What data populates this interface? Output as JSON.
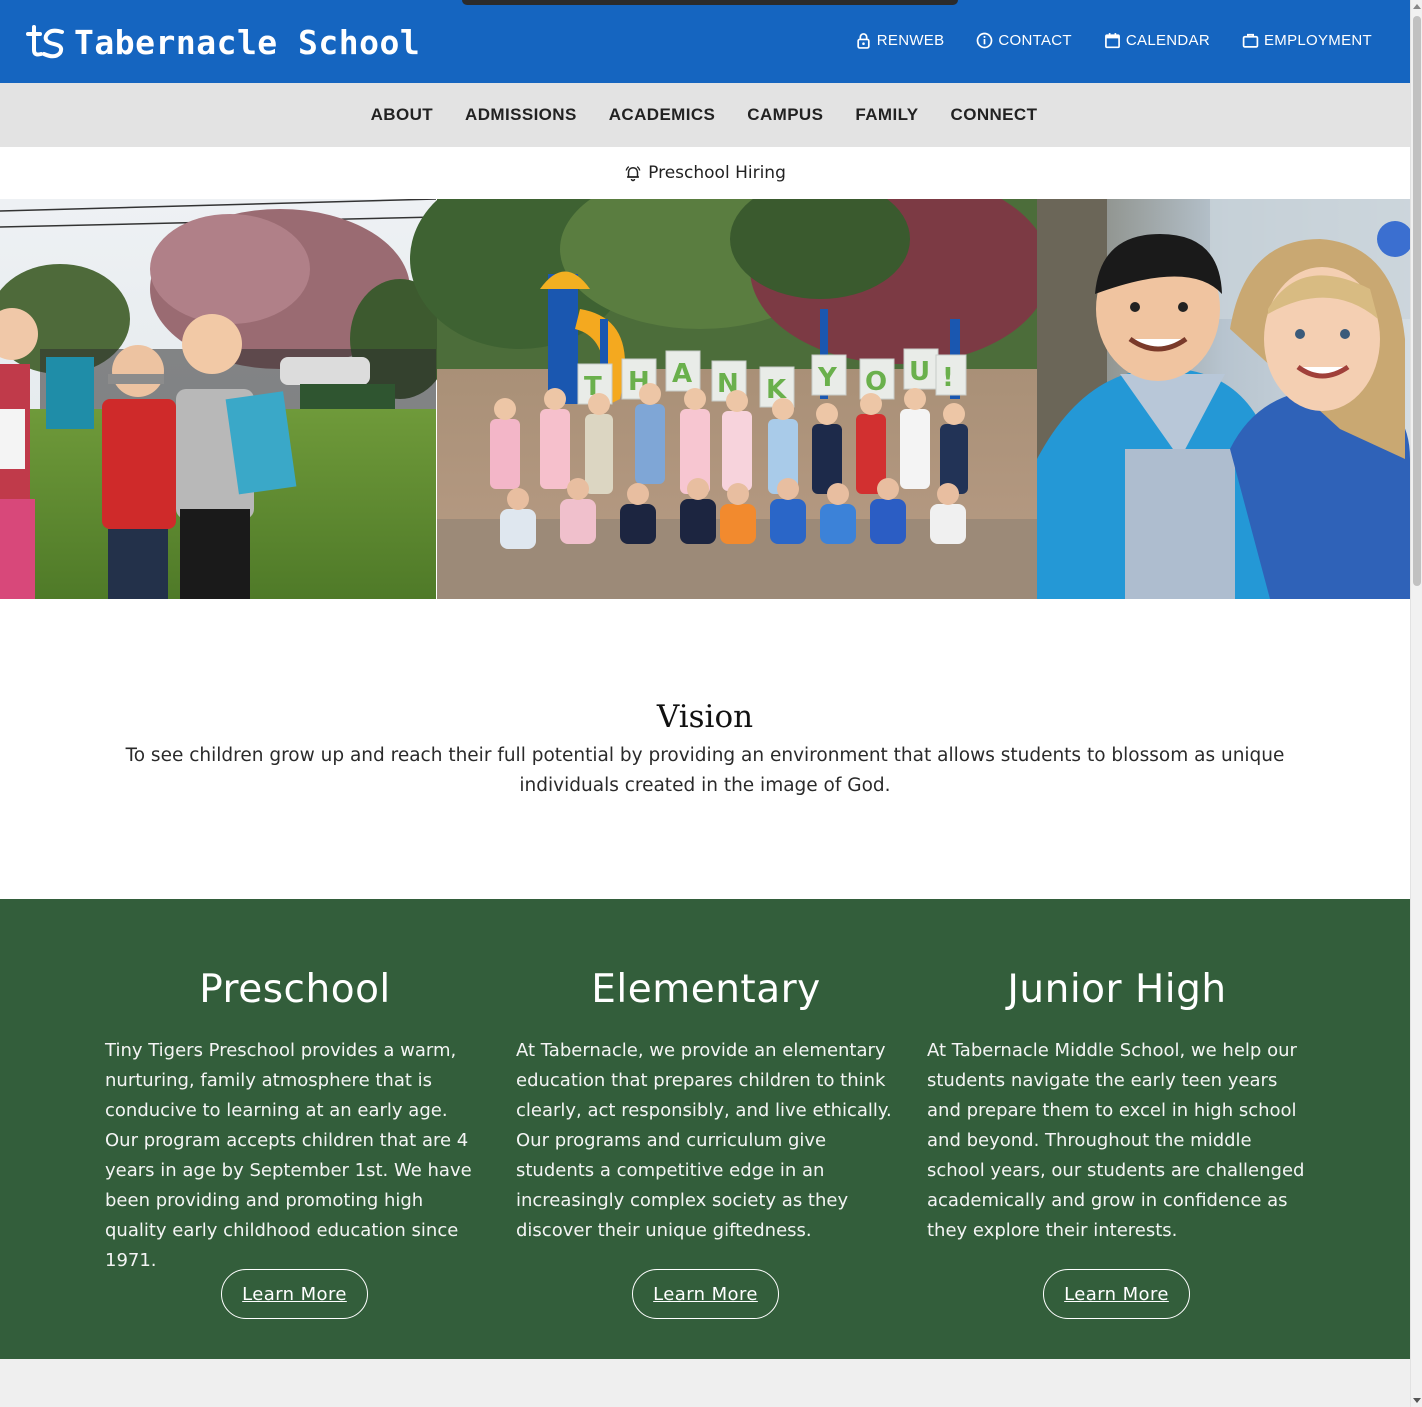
{
  "header": {
    "brand": "Tabernacle School",
    "utility_links": [
      {
        "label": "RENWEB",
        "icon": "lock-icon"
      },
      {
        "label": "CONTACT",
        "icon": "info-icon"
      },
      {
        "label": "CALENDAR",
        "icon": "calendar-icon"
      },
      {
        "label": "EMPLOYMENT",
        "icon": "briefcase-icon"
      }
    ],
    "colors": {
      "header_blue": "#1565c0",
      "nav_gray": "#e3e3e3"
    }
  },
  "main_nav": [
    {
      "label": "ABOUT"
    },
    {
      "label": "ADMISSIONS"
    },
    {
      "label": "ACADEMICS"
    },
    {
      "label": "CAMPUS"
    },
    {
      "label": "FAMILY"
    },
    {
      "label": "CONNECT"
    }
  ],
  "alert": {
    "icon": "bell-icon",
    "text": "Preschool Hiring"
  },
  "hero": {
    "slides": [
      {
        "name": "kids-with-books-photo"
      },
      {
        "name": "thank-you-playground-photo"
      },
      {
        "name": "smiling-students-photo"
      }
    ]
  },
  "vision": {
    "title": "Vision",
    "text": "To see children grow up and reach their full potential by providing an environment that allows students to blossom as unique individuals created in the image of God."
  },
  "programs": {
    "background": "#335e3b",
    "items": [
      {
        "title": "Preschool",
        "text": "Tiny Tigers  Preschool provides a warm, nurturing, family atmosphere that is conducive to learning at an early age. Our program accepts children that are 4 years in age by September 1st. We have been providing and promoting high quality early childhood education since 1971.",
        "button": "Learn More"
      },
      {
        "title": "Elementary",
        "text": "At Tabernacle, we provide an elementary education that prepares children to think clearly, act responsibly, and live ethically. Our programs and curriculum give students a competitive edge in an increasingly complex society as they discover their unique giftedness.",
        "button": "Learn More"
      },
      {
        "title": "Junior High",
        "text": "At Tabernacle  Middle School, we help our students navigate the early teen years and prepare them to excel in high school and beyond. Throughout the middle school years, our students are challenged academically and grow in confidence as they explore their interests.",
        "button": "Learn More"
      }
    ]
  }
}
